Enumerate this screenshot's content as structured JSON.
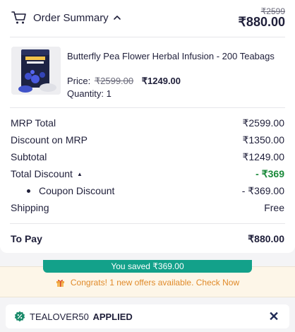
{
  "header": {
    "title": "Order Summary",
    "mrp_strike": "₹2599",
    "total": "₹880.00"
  },
  "product": {
    "name": "Butterfly Pea Flower Herbal Infusion - 200 Teabags",
    "price_label": "Price:",
    "original_price": "₹2599.00",
    "sale_price": "₹1249.00",
    "quantity": "Quantity: 1"
  },
  "summary": {
    "mrp_total_label": "MRP Total",
    "mrp_total_value": "₹2599.00",
    "discount_mrp_label": "Discount on MRP",
    "discount_mrp_value": "₹1350.00",
    "subtotal_label": "Subtotal",
    "subtotal_value": "₹1249.00",
    "total_discount_label": "Total Discount",
    "total_discount_value": "- ₹369",
    "coupon_discount_label": "Coupon Discount",
    "coupon_discount_value": "- ₹369.00",
    "shipping_label": "Shipping",
    "shipping_value": "Free",
    "to_pay_label": "To Pay",
    "to_pay_value": "₹880.00"
  },
  "offers": {
    "saved_text": "You saved ₹369.00",
    "congrats_text": "Congrats! 1 new offers available. Check Now"
  },
  "coupon": {
    "code": "TEALOVER50",
    "status": "APPLIED"
  },
  "colors": {
    "accent_green": "#1a8a3a",
    "pill_teal": "#13a18a",
    "offer_orange": "#e08a2a",
    "text_dark": "#1f1f3a"
  },
  "icons": [
    "cart-icon",
    "chevron-up-icon",
    "gift-icon",
    "coupon-badge-icon",
    "close-icon",
    "caret-up-icon",
    "bullet-icon"
  ]
}
